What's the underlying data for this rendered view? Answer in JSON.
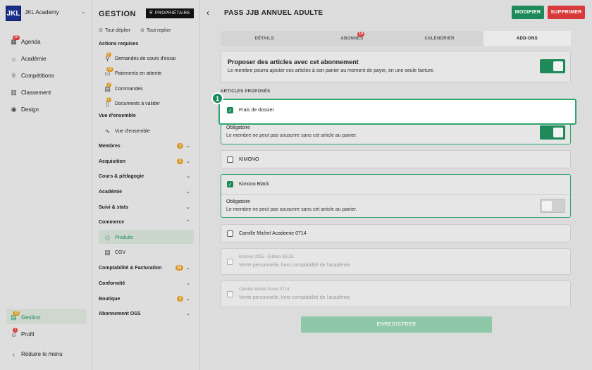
{
  "sidebar": {
    "org_name": "JKL Academy",
    "logo_text": "JKL",
    "items": [
      {
        "label": "Agenda",
        "icon": "calendar-icon",
        "badge": "20"
      },
      {
        "label": "Académie",
        "icon": "building-icon",
        "badge": ""
      },
      {
        "label": "Compétitions",
        "icon": "trophy-icon",
        "badge": ""
      },
      {
        "label": "Classement",
        "icon": "ranking-icon",
        "badge": ""
      },
      {
        "label": "Design",
        "icon": "palette-icon",
        "badge": ""
      }
    ],
    "gestion": {
      "label": "Gestion",
      "badge": "13"
    },
    "profil": {
      "label": "Profil",
      "badge": "1"
    },
    "collapse_label": "Réduire le menu"
  },
  "gestion": {
    "header": "GESTION",
    "owner_badge": "PROPRIÉTAIRE",
    "expand_all": "Tout déplier",
    "collapse_all": "Tout replier",
    "actions_title": "Actions requises",
    "actions": [
      {
        "label": "Demandes de cours d'essai",
        "badge": "1"
      },
      {
        "label": "Paiements en attente",
        "badge": "10"
      },
      {
        "label": "Commandes",
        "badge": "2"
      },
      {
        "label": "Documents à valider",
        "badge": "1"
      }
    ],
    "overview_title": "Vue d'ensemble",
    "overview_item": "Vue d'ensemble",
    "groups": [
      {
        "label": "Membres",
        "badge": "1"
      },
      {
        "label": "Acquisition",
        "badge": "1"
      },
      {
        "label": "Cours & pédagogie",
        "badge": ""
      },
      {
        "label": "Académie",
        "badge": ""
      },
      {
        "label": "Suivi & stats",
        "badge": ""
      },
      {
        "label": "Commerce",
        "badge": ""
      }
    ],
    "commerce_items": [
      "Produits",
      "CGV"
    ],
    "groups2": [
      {
        "label": "Comptabilité & Facturation",
        "badge": "10"
      },
      {
        "label": "Conformité",
        "badge": ""
      },
      {
        "label": "Boutique",
        "badge": "2"
      },
      {
        "label": "Abonnement OSS",
        "badge": ""
      }
    ]
  },
  "page": {
    "title": "PASS JJB ANNUEL ADULTE",
    "modify_label": "MODIFIER",
    "delete_label": "SUPPRIMER",
    "tabs": [
      {
        "label": "DÉTAILS",
        "badge": ""
      },
      {
        "label": "ABONNÉS",
        "badge": "10"
      },
      {
        "label": "CALENDRIER",
        "badge": ""
      },
      {
        "label": "ADD-ONS",
        "badge": ""
      }
    ],
    "propose_title": "Proposer des articles avec cet abonnement",
    "propose_desc": "Le membre pourra ajouter ces articles à son panier au moment de payer, en une seule facture.",
    "articles_title": "ARTICLES PROPOSÉS",
    "callout_number": "1",
    "articles": [
      {
        "name": "Frais de dossier",
        "checked": true,
        "mandatory_label": "Obligatoire",
        "mandatory_desc": "Le membre ne peut pas souscrire sans cet article au panier.",
        "mandatory": true
      },
      {
        "name": "KIMONO",
        "checked": false
      },
      {
        "name": "Kimono Black",
        "checked": true,
        "mandatory_label": "Obligatoire",
        "mandatory_desc": "Le membre ne peut pas souscrire sans cet article au panier.",
        "mandatory": false
      },
      {
        "name": "Camille Michel Academie 0714",
        "checked": false
      },
      {
        "name": "Kimono 2025 - Édition SEIZE",
        "checked": false,
        "disabled": true,
        "sub": "Vente personnelle, hors comptabilité de l'académie"
      },
      {
        "name": "Camille Michel Perso 0714",
        "checked": false,
        "disabled": true,
        "sub": "Vente personnelle, hors comptabilité de l'académie"
      }
    ],
    "save_label": "ENREGISTRER"
  }
}
